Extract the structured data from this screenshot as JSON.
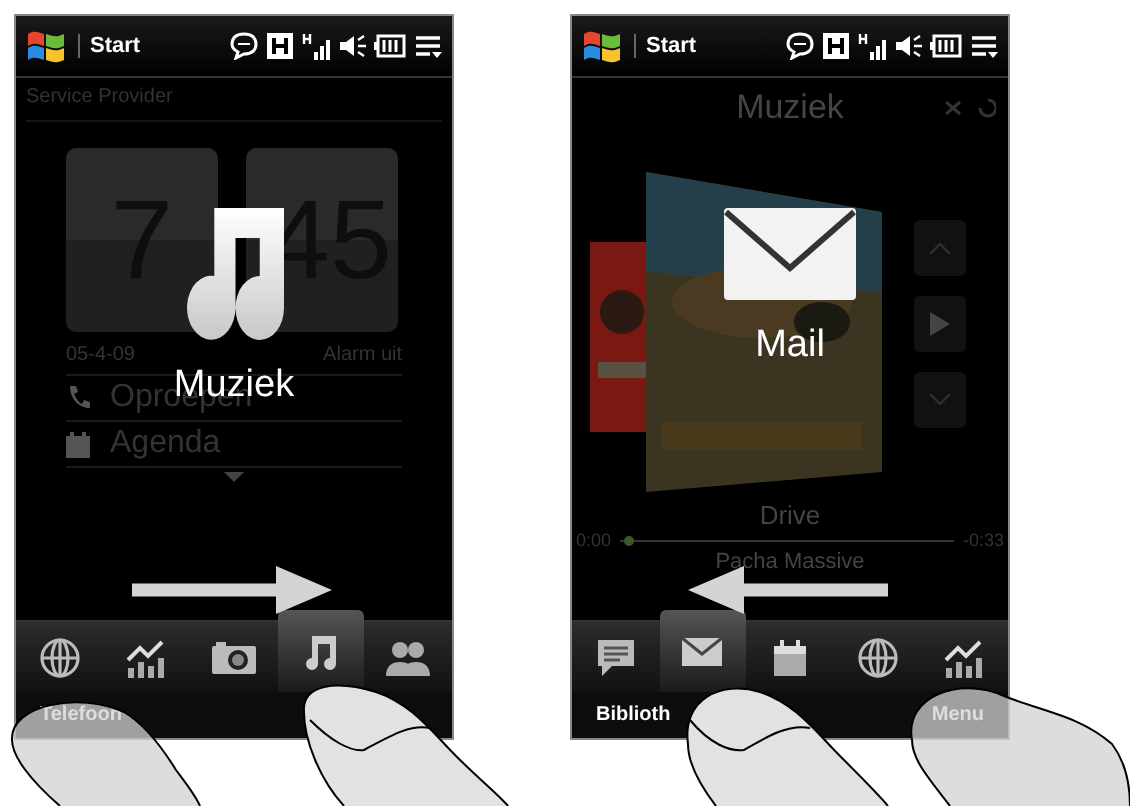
{
  "screens": [
    {
      "status_bar": {
        "start": "Start"
      },
      "kind": "home",
      "provider": "Service Provider",
      "clock": {
        "hours": "7",
        "minutes": "45"
      },
      "date": "05-4-09",
      "alarm": "Alarm uit",
      "list": [
        {
          "kind": "calls",
          "label": "Oproepen"
        },
        {
          "kind": "calendar",
          "label": "Agenda"
        }
      ],
      "overlay": {
        "kind": "music",
        "label": "Muziek"
      },
      "swipe": {
        "kind": "right"
      },
      "tabs": [
        {
          "kind": "globe",
          "selected": false
        },
        {
          "kind": "chart",
          "selected": false
        },
        {
          "kind": "camera",
          "selected": false
        },
        {
          "kind": "music",
          "selected": true
        },
        {
          "kind": "people",
          "selected": false
        }
      ],
      "softkeys": {
        "left": "Telefoon"
      }
    },
    {
      "status_bar": {
        "start": "Start"
      },
      "kind": "music",
      "title": "Muziek",
      "song": "Drive",
      "elapsed": "0:00",
      "remaining": "-0:33",
      "artist": "Pacha Massive",
      "overlay": {
        "kind": "mail",
        "label": "Mail"
      },
      "swipe": {
        "kind": "left"
      },
      "tabs": [
        {
          "kind": "message",
          "selected": false
        },
        {
          "kind": "mail",
          "selected": true
        },
        {
          "kind": "calendar",
          "selected": false
        },
        {
          "kind": "globe",
          "selected": false
        },
        {
          "kind": "chart",
          "selected": false
        }
      ],
      "softkeys": {
        "left": "Biblioth",
        "right": "Menu"
      }
    }
  ]
}
